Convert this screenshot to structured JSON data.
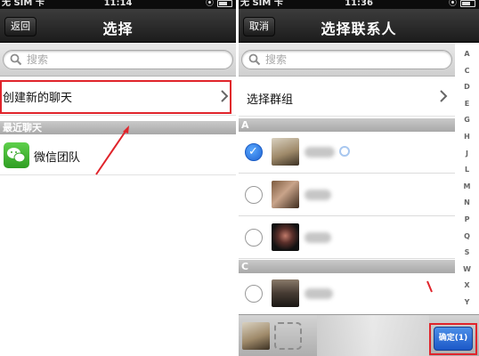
{
  "left": {
    "status": {
      "carrier": "无 SIM 卡",
      "time": "11:14"
    },
    "nav": {
      "back_label": "返回",
      "title": "选择"
    },
    "search": {
      "placeholder": "搜索"
    },
    "create_chat_label": "创建新的聊天",
    "section_recent": "最近聊天",
    "recent_items": [
      {
        "label": "微信团队",
        "icon": "wechat-icon"
      }
    ]
  },
  "right": {
    "status": {
      "carrier": "无 SIM 卡",
      "time": "11:36"
    },
    "nav": {
      "cancel_label": "取消",
      "title": "选择联系人"
    },
    "search": {
      "placeholder": "搜索"
    },
    "select_group_label": "选择群组",
    "sections": [
      {
        "header": "A",
        "contacts": [
          {
            "checked": true
          },
          {
            "checked": false
          },
          {
            "checked": false
          }
        ]
      },
      {
        "header": "C",
        "contacts": [
          {
            "checked": false
          }
        ]
      }
    ],
    "index_letters": [
      "A",
      "C",
      "D",
      "E",
      "G",
      "H",
      "J",
      "L",
      "M",
      "N",
      "P",
      "Q",
      "S",
      "W",
      "X",
      "Y"
    ],
    "confirm_label": "确定(1)"
  },
  "colors": {
    "highlight_red": "#e0242b",
    "wechat_green": "#3fb52c",
    "confirm_blue": "#2a6ad8",
    "nav_dark": "#1c1c1c"
  }
}
